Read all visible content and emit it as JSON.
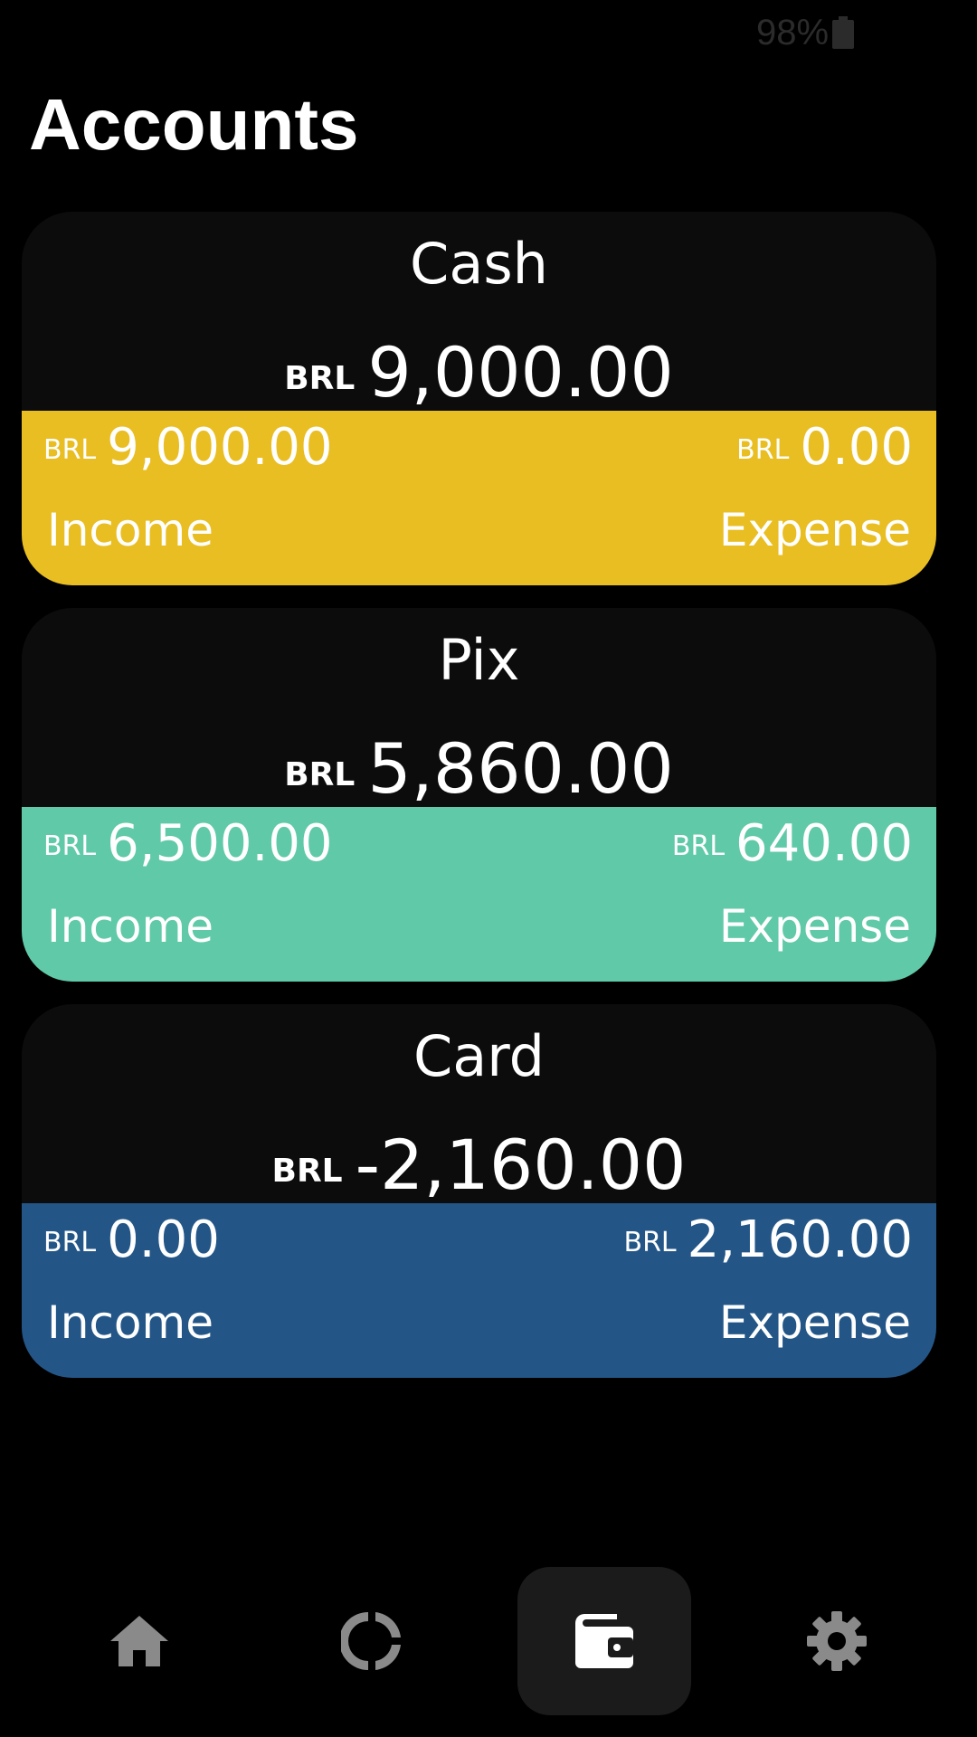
{
  "status_bar": {
    "battery_text": "98%",
    "battery_icon": "battery-icon"
  },
  "page": {
    "title": "Accounts"
  },
  "accounts": [
    {
      "name": "Cash",
      "currency": "BRL",
      "balance": "9,000.00",
      "income_amount": "9,000.00",
      "expense_amount": "0.00",
      "income_label": "Income",
      "expense_label": "Expense",
      "color": "#e9be22"
    },
    {
      "name": "Pix",
      "currency": "BRL",
      "balance": "5,860.00",
      "income_amount": "6,500.00",
      "expense_amount": "640.00",
      "income_label": "Income",
      "expense_label": "Expense",
      "color": "#60c9a8"
    },
    {
      "name": "Card",
      "currency": "BRL",
      "balance": "-2,160.00",
      "income_amount": "0.00",
      "expense_amount": "2,160.00",
      "income_label": "Income",
      "expense_label": "Expense",
      "color": "#235687"
    }
  ],
  "bottom_nav": {
    "items": [
      {
        "icon": "home-icon",
        "active": false
      },
      {
        "icon": "donut-chart-icon",
        "active": false
      },
      {
        "icon": "wallet-icon",
        "active": true
      },
      {
        "icon": "gear-icon",
        "active": false
      }
    ],
    "icon_color_inactive": "#8a8a8a",
    "icon_color_active": "#ffffff"
  }
}
